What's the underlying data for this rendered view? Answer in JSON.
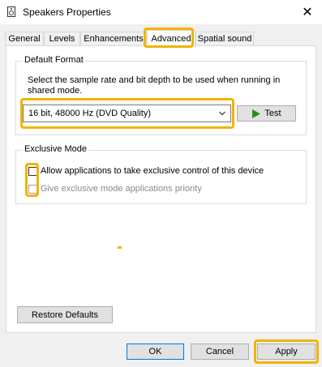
{
  "window": {
    "title": "Speakers Properties",
    "close_glyph": "✕"
  },
  "tabs": [
    {
      "label": "General"
    },
    {
      "label": "Levels"
    },
    {
      "label": "Enhancements"
    },
    {
      "label": "Advanced"
    },
    {
      "label": "Spatial sound"
    }
  ],
  "default_format": {
    "group_label": "Default Format",
    "description": "Select the sample rate and bit depth to be used when running in shared mode.",
    "selected_format": "16 bit, 48000 Hz (DVD Quality)",
    "test_label": "Test"
  },
  "exclusive_mode": {
    "group_label": "Exclusive Mode",
    "allow_label": "Allow applications to take exclusive control of this device",
    "allow_checked": false,
    "priority_label": "Give exclusive mode applications priority",
    "priority_checked": false,
    "priority_enabled": false
  },
  "restore_defaults_label": "Restore Defaults",
  "footer": {
    "ok_label": "OK",
    "cancel_label": "Cancel",
    "apply_label": "Apply"
  },
  "colors": {
    "highlight": "#f0b400",
    "play_icon": "#2e8b22",
    "accent": "#0078d7"
  },
  "icons": {
    "window": "speaker-icon",
    "close": "close-icon",
    "dropdown": "chevron-down-icon",
    "test": "play-icon"
  }
}
